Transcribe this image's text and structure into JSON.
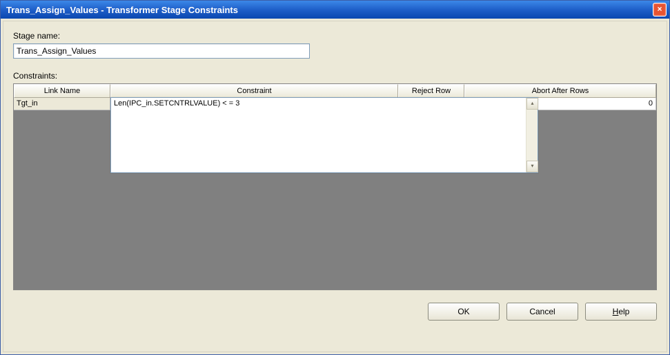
{
  "window": {
    "title": "Trans_Assign_Values - Transformer Stage Constraints",
    "close_glyph": "×"
  },
  "labels": {
    "stage_name": "Stage name:",
    "constraints": "Constraints:"
  },
  "stage_name_value": "Trans_Assign_Values",
  "grid": {
    "headers": {
      "link_name": "Link Name",
      "constraint": "Constraint",
      "reject_row": "Reject Row",
      "abort_after": "Abort After Rows"
    },
    "rows": [
      {
        "link_name": "Tgt_in",
        "constraint": "Len(IPC_in.SETCNTRLVALUE) < = 3",
        "reject_row": "",
        "abort_after": "0"
      }
    ]
  },
  "editor": {
    "value": "Len(IPC_in.SETCNTRLVALUE) < = 3",
    "scroll_up": "▴",
    "scroll_down": "▾"
  },
  "buttons": {
    "ok": "OK",
    "cancel": "Cancel",
    "help_pre": "",
    "help_u": "H",
    "help_post": "elp"
  }
}
